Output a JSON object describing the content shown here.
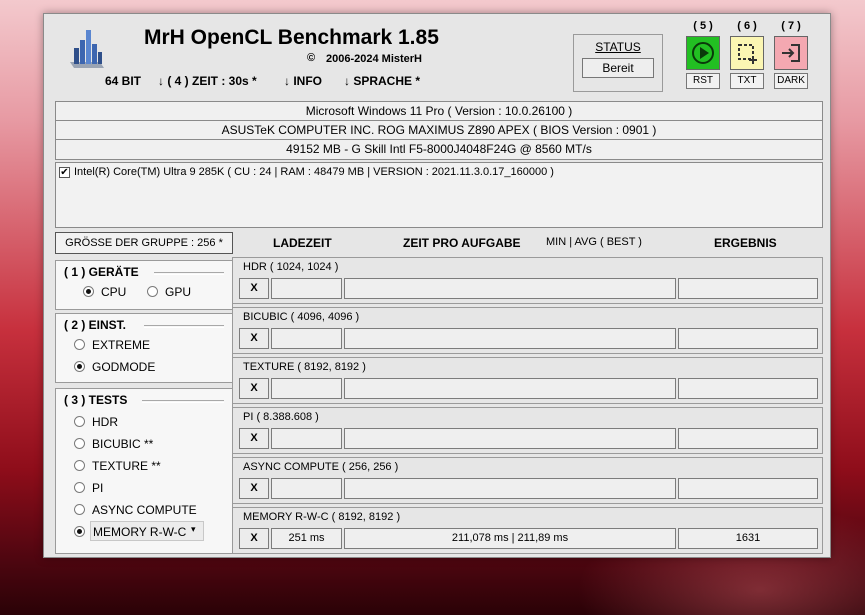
{
  "app": {
    "title": "MrH OpenCL Benchmark 1.85",
    "copyright_symbol": "©",
    "copyright": "2006-2024 MisterH",
    "logo_icon": "bar-chart-logo-icon"
  },
  "menu": {
    "bits": "64 BIT",
    "time": "↓ ( 4 ) ZEIT : 30s *",
    "info": "↓ INFO",
    "language": "↓ SPRACHE *"
  },
  "status": {
    "label": "STATUS",
    "value": "Bereit"
  },
  "tools": [
    {
      "num": "( 5 )",
      "label": "RST",
      "icon": "play-icon",
      "color": "#21c021"
    },
    {
      "num": "( 6 )",
      "label": "TXT",
      "icon": "selection-plus-icon",
      "color": "#fbf7b4"
    },
    {
      "num": "( 7 )",
      "label": "DARK",
      "icon": "sign-in-icon",
      "color": "#f5a9b2"
    }
  ],
  "system": {
    "os": "Microsoft Windows 11 Pro ( Version : 10.0.26100 )",
    "board": "ASUSTeK COMPUTER INC. ROG MAXIMUS Z890 APEX ( BIOS Version : 0901 )",
    "memory": "49152 MB - G Skill Intl F5-8000J4048F24G     @ 8560 MT/s"
  },
  "device": {
    "checked": true,
    "label": "Intel(R) Core(TM) Ultra 9 285K ( CU : 24 | RAM : 48479 MB | VERSION : 2021.11.3.0.17_160000 )"
  },
  "group_size": "GRÖSSE DER GRUPPE : 256 *",
  "columns": {
    "load": "LADEZEIT",
    "time": "ZEIT PRO AUFGABE",
    "minavg": "MIN | AVG ( BEST )",
    "result": "ERGEBNIS"
  },
  "devices_group": {
    "title": "( 1 ) GERÄTE",
    "options": [
      {
        "label": "CPU",
        "selected": true
      },
      {
        "label": "GPU",
        "selected": false
      }
    ]
  },
  "settings_group": {
    "title": "( 2 ) EINST.",
    "options": [
      {
        "label": "EXTREME",
        "selected": false
      },
      {
        "label": "GODMODE",
        "selected": true
      }
    ]
  },
  "tests_group": {
    "title": "( 3 ) TESTS",
    "options": [
      {
        "label": "HDR",
        "selected": false
      },
      {
        "label": "BICUBIC **",
        "selected": false
      },
      {
        "label": "TEXTURE **",
        "selected": false
      },
      {
        "label": "PI",
        "selected": false
      },
      {
        "label": "ASYNC COMPUTE",
        "selected": false
      },
      {
        "label": "MEMORY R-W-C",
        "selected": true
      }
    ]
  },
  "tests": [
    {
      "title": "HDR ( 1024, 1024 )",
      "x": "X",
      "load": "",
      "time": "",
      "result": ""
    },
    {
      "title": "BICUBIC ( 4096, 4096 )",
      "x": "X",
      "load": "",
      "time": "",
      "result": ""
    },
    {
      "title": "TEXTURE ( 8192, 8192 )",
      "x": "X",
      "load": "",
      "time": "",
      "result": ""
    },
    {
      "title": "PI ( 8.388.608 )",
      "x": "X",
      "load": "",
      "time": "",
      "result": ""
    },
    {
      "title": "ASYNC COMPUTE ( 256, 256 )",
      "x": "X",
      "load": "",
      "time": "",
      "result": ""
    },
    {
      "title": "MEMORY R-W-C ( 8192, 8192 )",
      "x": "X",
      "load": "251 ms",
      "time": "211,078 ms | 211,89 ms",
      "result": "1631"
    }
  ]
}
